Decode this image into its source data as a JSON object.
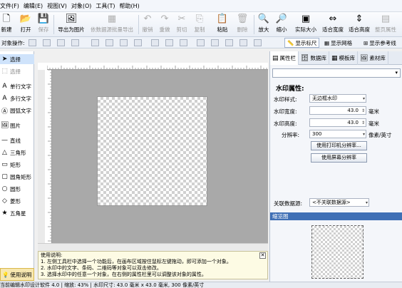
{
  "menu": [
    "文件(F)",
    "编辑(E)",
    "视图(V)",
    "对象(O)",
    "工具(T)",
    "帮助(H)"
  ],
  "toolbar": {
    "new": "新建",
    "open": "打开",
    "save": "保存",
    "export_image": "导出为图片",
    "export_data_image": "依数据源批量导出",
    "undo": "撤销",
    "redo": "重做",
    "cut": "剪切",
    "copy": "复制",
    "paste": "粘贴",
    "delete": "删除",
    "zoom_in": "放大",
    "zoom_out": "缩小",
    "actual_size": "实际大小",
    "fit_width": "适合宽度",
    "fit_height": "适合高度",
    "page_properties": "整页属性"
  },
  "objbar": {
    "label": "对象操作:",
    "show_ruler": "显示标尺",
    "show_grid": "显示网格",
    "show_guides": "显示参考线"
  },
  "tools": [
    {
      "label": "选择",
      "icon": "arrow-icon"
    },
    {
      "label": "选择",
      "icon": "marquee-icon"
    },
    {
      "label": "单行文字",
      "icon": "text-icon"
    },
    {
      "label": "多行文字",
      "icon": "multiline-text-icon"
    },
    {
      "label": "圆弧文字",
      "icon": "arc-text-icon"
    },
    {
      "label": "图片",
      "icon": "image-icon"
    },
    {
      "label": "直线",
      "icon": "line-icon"
    },
    {
      "label": "三角形",
      "icon": "triangle-icon"
    },
    {
      "label": "矩形",
      "icon": "rectangle-icon"
    },
    {
      "label": "圆角矩形",
      "icon": "rounded-rect-icon"
    },
    {
      "label": "圆形",
      "icon": "circle-icon"
    },
    {
      "label": "菱形",
      "icon": "diamond-icon"
    },
    {
      "label": "五角星",
      "icon": "star-icon"
    }
  ],
  "help_button": "使用说明",
  "usage": {
    "title": "使用说明:",
    "lines": [
      "1. 左侧工具栏中选择一个功能后，在画布区域按住鼠标左键拖动，即可添加一个对象。",
      "2. 水印中的文字、条码、二维码等对象可以双击修改。",
      "3. 选择水印中的任意一个对象，在右侧的属性栏里可以调整该对象的属性。"
    ]
  },
  "status": "当前编辑水印设计软件 4.0 | 缩放: 43% | 水印尺寸: 43.0 毫米 x 43.0 毫米, 300 像素/英寸",
  "right": {
    "tabs": [
      "属性栏",
      "数据库",
      "模板库",
      "素材库"
    ],
    "wm_title": "水印属性:",
    "style_label": "水印样式:",
    "style_value": "无边框水印",
    "width_label": "水印宽度:",
    "width_value": "43.0",
    "height_label": "水印高度:",
    "height_value": "43.0",
    "unit_mm": "毫米",
    "dpi_label": "分辨率:",
    "dpi_value": "300",
    "dpi_unit": "像素/英寸",
    "btn_printer_dpi": "使用打印机分辨率...",
    "btn_screen_dpi": "使用屏幕分辨率",
    "link_label": "关联数据源:",
    "link_value": "<不关联数据源>",
    "preview_title": "缩览图"
  }
}
